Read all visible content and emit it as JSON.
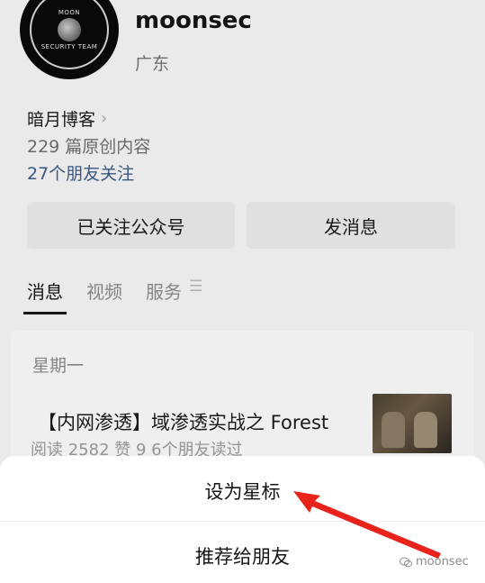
{
  "profile": {
    "name": "moonsec",
    "region": "广东",
    "avatar_text": [
      "MOON",
      "SECURITY TEAM"
    ]
  },
  "info": {
    "blog": "暗月博客",
    "articles": "229 篇原创内容",
    "friends": "27个朋友关注"
  },
  "buttons": {
    "follow": "已关注公众号",
    "message": "发消息"
  },
  "tabs": [
    {
      "label": "消息",
      "active": true
    },
    {
      "label": "视频",
      "active": false
    },
    {
      "label": "服务",
      "active": false
    }
  ],
  "tab_menu_icon": "menu-icon",
  "card": {
    "day": "星期一",
    "title": "【内网渗透】域渗透实战之 Forest",
    "meta": "阅读 2582  赞 9  6个朋友读过"
  },
  "sheet": {
    "set_star": "设为星标",
    "recommend": "推荐给朋友"
  },
  "annotation_arrow_color": "#e8231c",
  "watermark": "moonsec"
}
